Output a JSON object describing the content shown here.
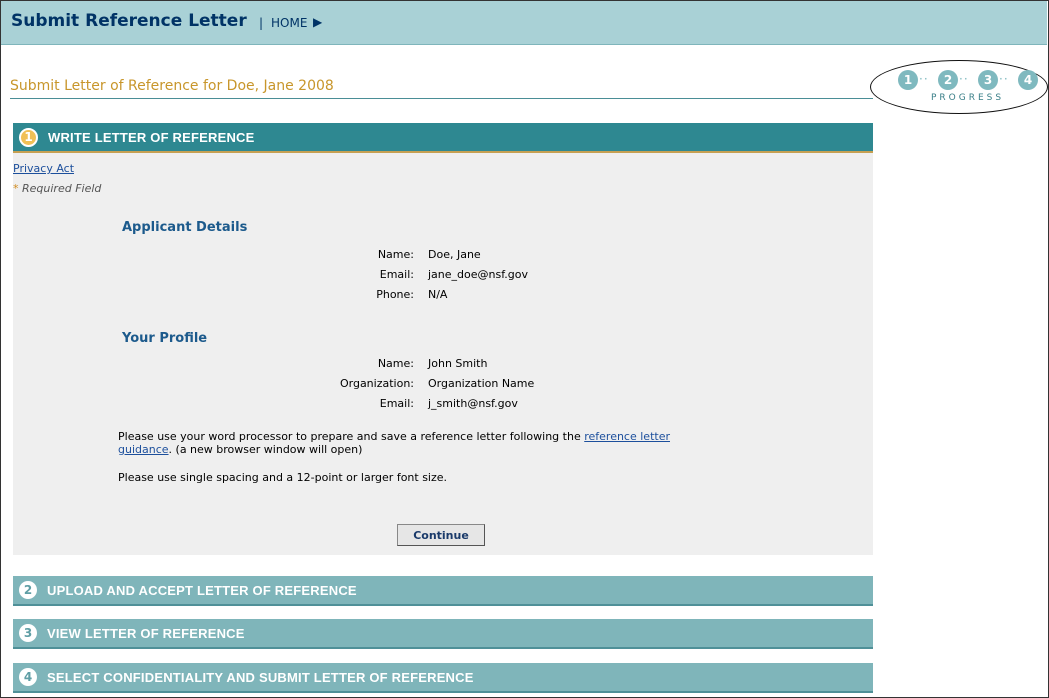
{
  "header": {
    "title": "Submit Reference Letter",
    "separator": "|",
    "home": "HOME",
    "arrow": "▶"
  },
  "page": {
    "title": "Submit Letter of Reference for Doe, Jane 2008"
  },
  "progress": {
    "steps": [
      "1",
      "2",
      "3",
      "4"
    ],
    "label": "PROGRESS"
  },
  "sections": [
    {
      "number": "1",
      "label": "WRITE LETTER OF REFERENCE"
    },
    {
      "number": "2",
      "label": "UPLOAD AND ACCEPT LETTER OF REFERENCE"
    },
    {
      "number": "3",
      "label": "VIEW LETTER OF REFERENCE"
    },
    {
      "number": "4",
      "label": "SELECT CONFIDENTIALITY AND SUBMIT LETTER OF REFERENCE"
    }
  ],
  "links": {
    "privacy": "Privacy Act"
  },
  "required": {
    "asterisk": "*",
    "text": "Required Field"
  },
  "applicant": {
    "heading": "Applicant Details",
    "name_label": "Name:",
    "name": "Doe, Jane",
    "email_label": "Email:",
    "email": "jane_doe@nsf.gov",
    "phone_label": "Phone:",
    "phone": "N/A"
  },
  "profile": {
    "heading": "Your Profile",
    "name_label": "Name:",
    "name": "John Smith",
    "org_label": "Organization:",
    "org": "Organization Name",
    "email_label": "Email:",
    "email": "j_smith@nsf.gov"
  },
  "instructions": {
    "p1_before": "Please use your word processor to prepare and save a reference letter following the ",
    "p1_link_a": "reference letter",
    "p1_link_b": "guidance",
    "p1_after": ". (a new browser window will open)",
    "p2": "Please use single spacing and a 12-point or larger font size."
  },
  "buttons": {
    "continue": "Continue"
  }
}
